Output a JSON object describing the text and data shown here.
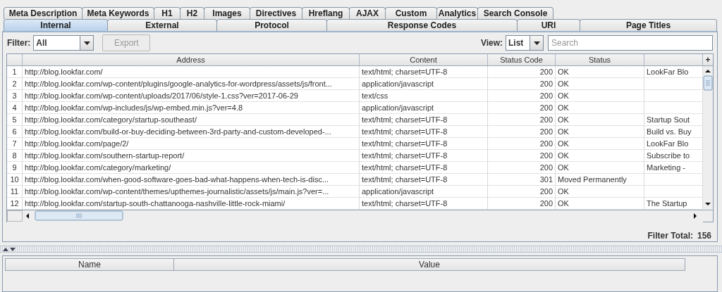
{
  "tabs_row_1": [
    {
      "label": "Meta Description",
      "selected": false
    },
    {
      "label": "Meta Keywords",
      "selected": false
    },
    {
      "label": "H1",
      "selected": false
    },
    {
      "label": "H2",
      "selected": false
    },
    {
      "label": "Images",
      "selected": false
    },
    {
      "label": "Directives",
      "selected": false
    },
    {
      "label": "Hreflang",
      "selected": false
    },
    {
      "label": "AJAX",
      "selected": false
    },
    {
      "label": "Custom",
      "selected": false
    },
    {
      "label": "Analytics",
      "selected": false
    },
    {
      "label": "Search Console",
      "selected": false
    }
  ],
  "tabs_row_2": [
    {
      "label": "Internal",
      "selected": true
    },
    {
      "label": "External",
      "selected": false
    },
    {
      "label": "Protocol",
      "selected": false
    },
    {
      "label": "Response Codes",
      "selected": false
    },
    {
      "label": "URI",
      "selected": false
    },
    {
      "label": "Page Titles",
      "selected": false
    }
  ],
  "toolbar": {
    "filter_label": "Filter:",
    "filter_value": "All",
    "export_button": {
      "label": "Export",
      "disabled": true
    },
    "view_label": "View:",
    "view_value": "List",
    "search": {
      "placeholder": "Search"
    }
  },
  "table": {
    "columns": [
      "Address",
      "Content",
      "Status Code",
      "Status"
    ],
    "add_column_button": "+",
    "rows": [
      {
        "number": "1",
        "address": "http://blog.lookfar.com/",
        "content": "text/html; charset=UTF-8",
        "status_code": "200",
        "status": "OK",
        "column_6": "LookFar Blo"
      },
      {
        "number": "2",
        "address": "http://blog.lookfar.com/wp-content/plugins/google-analytics-for-wordpress/assets/js/front...",
        "content": "application/javascript",
        "status_code": "200",
        "status": "OK"
      },
      {
        "number": "3",
        "address": "http://blog.lookfar.com/wp-content/uploads/2017/06/style-1.css?ver=2017-06-29",
        "content": "text/css",
        "status_code": "200",
        "status": "OK"
      },
      {
        "number": "4",
        "address": "http://blog.lookfar.com/wp-includes/js/wp-embed.min.js?ver=4.8",
        "content": "application/javascript",
        "status_code": "200",
        "status": "OK"
      },
      {
        "number": "5",
        "address": "http://blog.lookfar.com/category/startup-southeast/",
        "content": "text/html; charset=UTF-8",
        "status_code": "200",
        "status": "OK",
        "column_6": "Startup Sout"
      },
      {
        "number": "6",
        "address": "http://blog.lookfar.com/build-or-buy-deciding-between-3rd-party-and-custom-developed-...",
        "content": "text/html; charset=UTF-8",
        "status_code": "200",
        "status": "OK",
        "column_6": "Build vs. Buy"
      },
      {
        "number": "7",
        "address": "http://blog.lookfar.com/page/2/",
        "content": "text/html; charset=UTF-8",
        "status_code": "200",
        "status": "OK",
        "column_6": "LookFar Blo"
      },
      {
        "number": "8",
        "address": "http://blog.lookfar.com/southern-startup-report/",
        "content": "text/html; charset=UTF-8",
        "status_code": "200",
        "status": "OK",
        "column_6": "Subscribe to"
      },
      {
        "number": "9",
        "address": "http://blog.lookfar.com/category/marketing/",
        "content": "text/html; charset=UTF-8",
        "status_code": "200",
        "status": "OK",
        "column_6": "Marketing -"
      },
      {
        "number": "10",
        "address": "http://blog.lookfar.com/when-good-software-goes-bad-what-happens-when-tech-is-disc...",
        "content": "text/html; charset=UTF-8",
        "status_code": "301",
        "status": "Moved Permanently"
      },
      {
        "number": "11",
        "address": "http://blog.lookfar.com/wp-content/themes/upthemes-journalistic/assets/js/main.js?ver=...",
        "content": "application/javascript",
        "status_code": "200",
        "status": "OK"
      },
      {
        "number": "12",
        "address": "http://blog.lookfar.com/startup-south-chattanooga-nashville-little-rock-miami/",
        "content": "text/html; charset=UTF-8",
        "status_code": "200",
        "status": "OK",
        "column_6": "The Startup"
      }
    ]
  },
  "filter_total": {
    "label": "Filter Total:",
    "value": "156"
  },
  "detail_table": {
    "columns": [
      "Name",
      "Value"
    ]
  }
}
